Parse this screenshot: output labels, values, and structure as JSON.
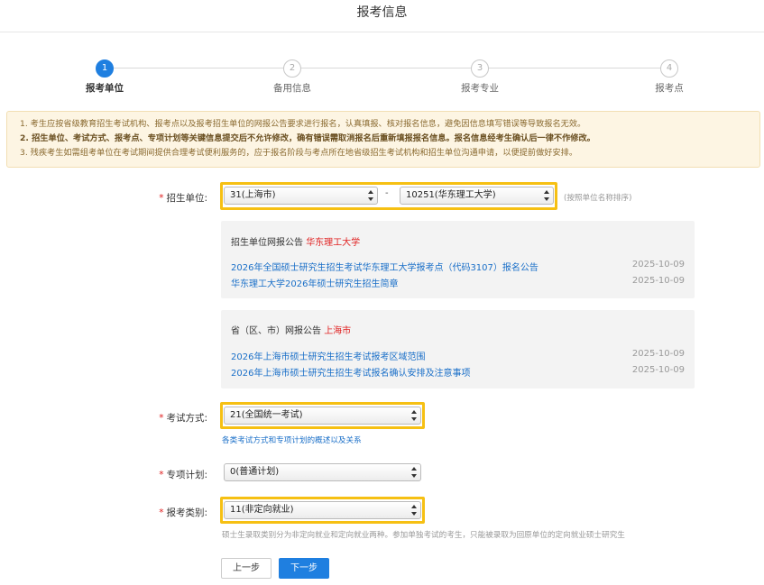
{
  "title": "报考信息",
  "steps": [
    {
      "num": "1",
      "label": "报考单位"
    },
    {
      "num": "2",
      "label": "备用信息"
    },
    {
      "num": "3",
      "label": "报考专业"
    },
    {
      "num": "4",
      "label": "报考点"
    }
  ],
  "notice": [
    "1. 考生应按省级教育招生考试机构、报考点以及报考招生单位的网报公告要求进行报名，认真填报、核对报名信息，避免因信息填写错误等导致报名无效。",
    "2. 招生单位、考试方式、报考点、专项计划等关键信息提交后不允许修改，确有错误需取消报名后重新填报报名信息。报名信息经考生确认后一律不作修改。",
    "3. 残疾考生如需组考单位在考试期间提供合理考试便利服务的，应于报名阶段与考点所在地省级招生考试机构和招生单位沟通申请，以便提前做好安排。"
  ],
  "form": {
    "required_mark": "*",
    "unit_label": "招生单位:",
    "province_value": "31(上海市)",
    "separator": "-",
    "school_value": "10251(华东理工大学)",
    "sort_hint": "(按照单位名称排序)",
    "exam_label": "考试方式:",
    "exam_value": "21(全国统一考试)",
    "exam_link": "各类考试方式和专项计划的概述以及关系",
    "plan_label": "专项计划:",
    "plan_value": "0(普通计划)",
    "category_label": "报考类别:",
    "category_value": "11(非定向就业)",
    "category_hint": "硕士生录取类别分为非定向就业和定向就业两种。参加单独考试的考生，只能被录取为回原单位的定向就业硕士研究生"
  },
  "school_panel": {
    "title": "招生单位网报公告",
    "highlight": "华东理工大学",
    "items": [
      {
        "text": "2026年全国硕士研究生招生考试华东理工大学报考点（代码3107）报名公告",
        "date": "2025-10-09"
      },
      {
        "text": "华东理工大学2026年硕士研究生招生简章",
        "date": "2025-10-09"
      }
    ]
  },
  "province_panel": {
    "title": "省（区、市）网报公告",
    "highlight": "上海市",
    "items": [
      {
        "text": "2026年上海市硕士研究生招生考试报考区域范围",
        "date": "2025-10-09"
      },
      {
        "text": "2026年上海市硕士研究生招生考试报名确认安排及注意事项",
        "date": "2025-10-09"
      }
    ]
  },
  "buttons": {
    "prev": "上一步",
    "next": "下一步"
  },
  "colors": {
    "accent": "#1f7fe0",
    "highlight_border": "#f6c013",
    "required": "#e02020",
    "notice_bg": "#fdf5e3"
  }
}
